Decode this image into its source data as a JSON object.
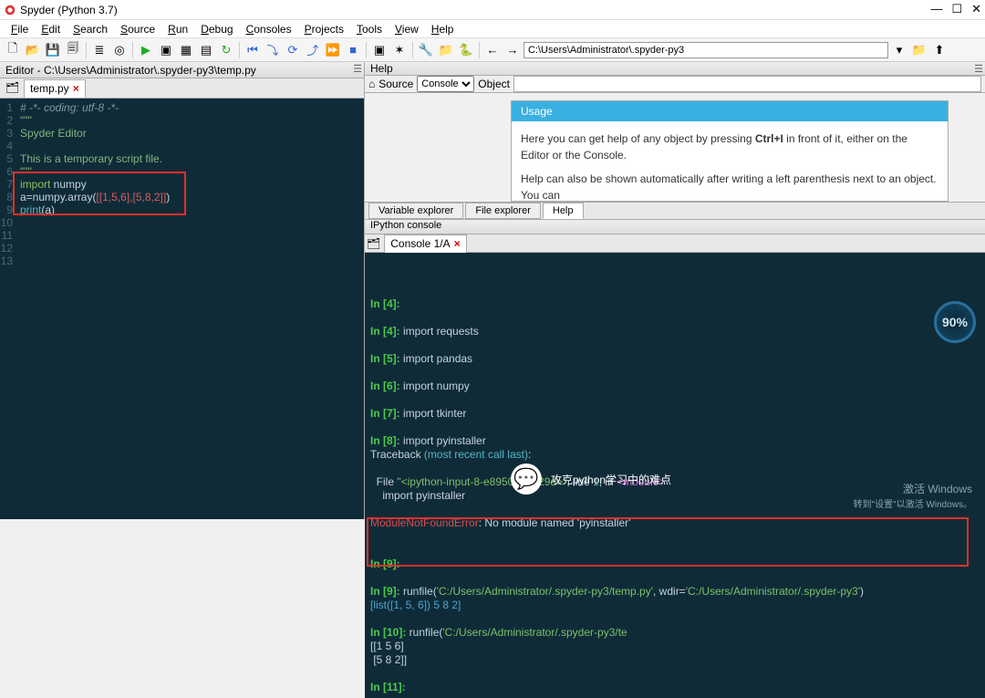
{
  "window": {
    "title": "Spyder (Python 3.7)"
  },
  "menu": [
    "File",
    "Edit",
    "Search",
    "Source",
    "Run",
    "Debug",
    "Consoles",
    "Projects",
    "Tools",
    "View",
    "Help"
  ],
  "toolbar": {
    "path": "C:\\Users\\Administrator\\.spyder-py3"
  },
  "editor": {
    "pane_title": "Editor - C:\\Users\\Administrator\\.spyder-py3\\temp.py",
    "tab_name": "temp.py"
  },
  "source_code": {
    "lines": [
      {
        "n": 1,
        "text": "# -*- coding: utf-8 -*-",
        "cls": "c-comment"
      },
      {
        "n": 2,
        "text": "\"\"\"",
        "cls": "c-str"
      },
      {
        "n": 3,
        "text": "Spyder Editor",
        "cls": "c-str"
      },
      {
        "n": 4,
        "text": "",
        "cls": ""
      },
      {
        "n": 5,
        "text": "This is a temporary script file.",
        "cls": "c-str"
      },
      {
        "n": 6,
        "text": "\"\"\"",
        "cls": "c-str"
      },
      {
        "n": 7,
        "raw": "<span class='c-import'>import</span> numpy"
      },
      {
        "n": 8,
        "raw": "a=numpy.array(<span class='c-num'>[[1,5,6],[5,8,2]]</span>)"
      },
      {
        "n": 9,
        "raw": "<span class='c-fn'>print</span>(a)"
      },
      {
        "n": 10,
        "text": "",
        "cls": ""
      },
      {
        "n": 11,
        "text": "",
        "cls": ""
      },
      {
        "n": 12,
        "text": "",
        "cls": ""
      },
      {
        "n": 13,
        "text": "",
        "cls": ""
      }
    ]
  },
  "help": {
    "title": "Help",
    "source_label": "Source",
    "source_dropdown": "Console",
    "object_label": "Object",
    "usage_title": "Usage",
    "body1_pre": "Here you can get help of any object by pressing ",
    "body1_key": "Ctrl+I",
    "body1_post": " in front of it, either on the Editor or the Console.",
    "body2": "Help can also be shown automatically after writing a left parenthesis next to an object. You can",
    "tabs": [
      "Variable explorer",
      "File explorer",
      "Help"
    ]
  },
  "console": {
    "title": "IPython console",
    "tab": "Console 1/A"
  },
  "console_lines": [
    "<span class='p-in'>In [4]:</span>",
    "",
    "<span class='p-in'>In [4]:</span> import requests",
    "",
    "<span class='p-in'>In [5]:</span> import pandas",
    "",
    "<span class='p-in'>In [6]:</span> import numpy",
    "",
    "<span class='p-in'>In [7]:</span> import tkinter",
    "",
    "<span class='p-in'>In [8]:</span> import pyinstaller",
    "Traceback <span class='p-cyan'>(most recent call last)</span>:",
    "",
    "  File <span class='p-str'>\"&lt;ipython-input-8-e8950ad1a29d&gt;\"</span>, line <span class='p-cyan'>1</span>, in <span class='p-mag'>&lt;module&gt;</span>",
    "    import pyinstaller",
    "",
    "<span class='p-err'>ModuleNotFoundError</span>: No module named 'pyinstaller'",
    "",
    "",
    "<span class='p-in'>In [9]:</span>",
    "",
    "<span class='p-in'>In [9]:</span> runfile(<span class='p-str'>'C:/Users/Administrator/.spyder-py3/temp.py'</span>, wdir=<span class='p-str'>'C:/Users/Administrator/.spyder-py3'</span>)",
    "<span class='p-blue'>[list([1, 5, 6]) 5 8 2]</span>",
    "",
    "<span class='p-in'>In [10]:</span> runfile(<span class='p-str'>'C:/Users/Administrator/.spyder-py3/te</span>",
    "[[1 5 6]",
    " [5 8 2]]",
    "",
    "<span class='p-in'>In [11]:</span>"
  ],
  "badge": "90%",
  "watermark": "攻克python学习中的难点",
  "activate": {
    "line1": "激活 Windows",
    "line2": "转到\"设置\"以激活 Windows。"
  }
}
